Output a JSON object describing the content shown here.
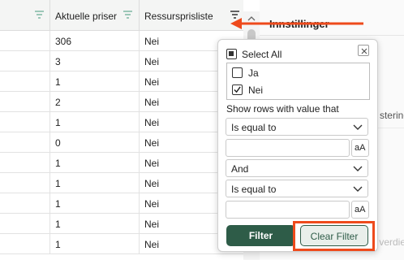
{
  "grid": {
    "columns": [
      {
        "label": ""
      },
      {
        "label": "Aktuelle priser"
      },
      {
        "label": "Ressursprisliste"
      }
    ],
    "rows": [
      [
        "",
        "306",
        "Nei"
      ],
      [
        "",
        "3",
        "Nei"
      ],
      [
        "",
        "1",
        "Nei"
      ],
      [
        "",
        "2",
        "Nei"
      ],
      [
        "",
        "1",
        "Nei"
      ],
      [
        "",
        "0",
        "Nei"
      ],
      [
        "",
        "1",
        "Nei"
      ],
      [
        "",
        "1",
        "Nei"
      ],
      [
        "",
        "1",
        "Nei"
      ],
      [
        "",
        "1",
        "Nei"
      ],
      [
        "",
        "1",
        "Nei"
      ]
    ]
  },
  "side_panel": {
    "title": "Innstillinger",
    "items": [
      "stering",
      "verdier"
    ]
  },
  "filter_popup": {
    "select_all_label": "Select All",
    "values": [
      {
        "label": "Ja",
        "checked": false
      },
      {
        "label": "Nei",
        "checked": true
      }
    ],
    "condition_label": "Show rows with value that",
    "condition_1": "Is equal to",
    "value_1": "",
    "join_operator": "And",
    "condition_2": "Is equal to",
    "value_2": "",
    "case_toggle_label": "aA",
    "filter_button": "Filter",
    "clear_filter_button": "Clear Filter"
  },
  "colors": {
    "primary_green": "#2e5c48",
    "annotation_red": "#ee4a1c",
    "header_bg": "#f4f5f4"
  }
}
